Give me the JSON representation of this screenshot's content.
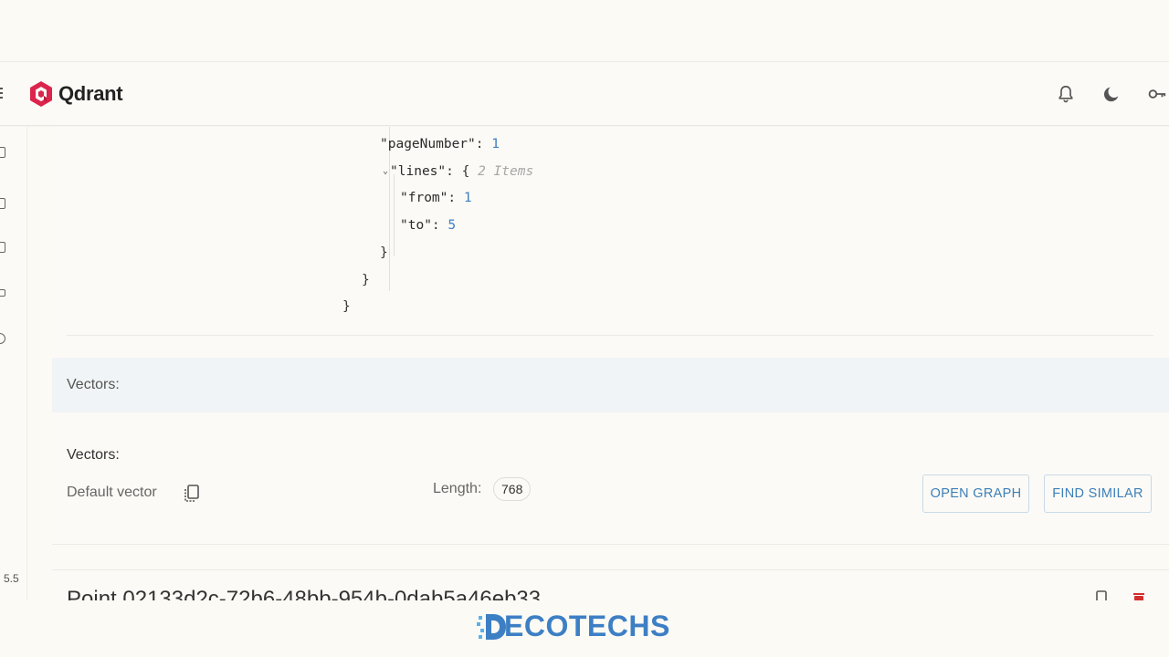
{
  "header": {
    "logo_text": "Qdrant",
    "icons": [
      "bell-icon",
      "moon-icon",
      "key-icon"
    ]
  },
  "sidebar": {
    "version": "5.5"
  },
  "payload_json": {
    "page_number_key": "\"pageNumber\"",
    "page_number_value": "1",
    "lines_key": "\"lines\"",
    "lines_hint": "2 Items",
    "from_key": "\"from\"",
    "from_value": "1",
    "to_key": "\"to\"",
    "to_value": "5",
    "colon": ":",
    "open_brace": "{",
    "close_brace": "}"
  },
  "vectors_section": {
    "band_label": "Vectors:",
    "label": "Vectors:",
    "default_vector_label": "Default vector",
    "length_label": "Length:",
    "length_value": "768",
    "open_graph_label": "OPEN GRAPH",
    "find_similar_label": "FIND SIMILAR"
  },
  "next_point": {
    "title": "Point 02133d2c-72b6-48bb-954b-0dab5a46eb33"
  },
  "watermark": {
    "text": "ECOTECHS"
  },
  "colors": {
    "accent": "#3d7fc4",
    "logo_red": "#dc244c",
    "danger": "#d32f2f"
  }
}
